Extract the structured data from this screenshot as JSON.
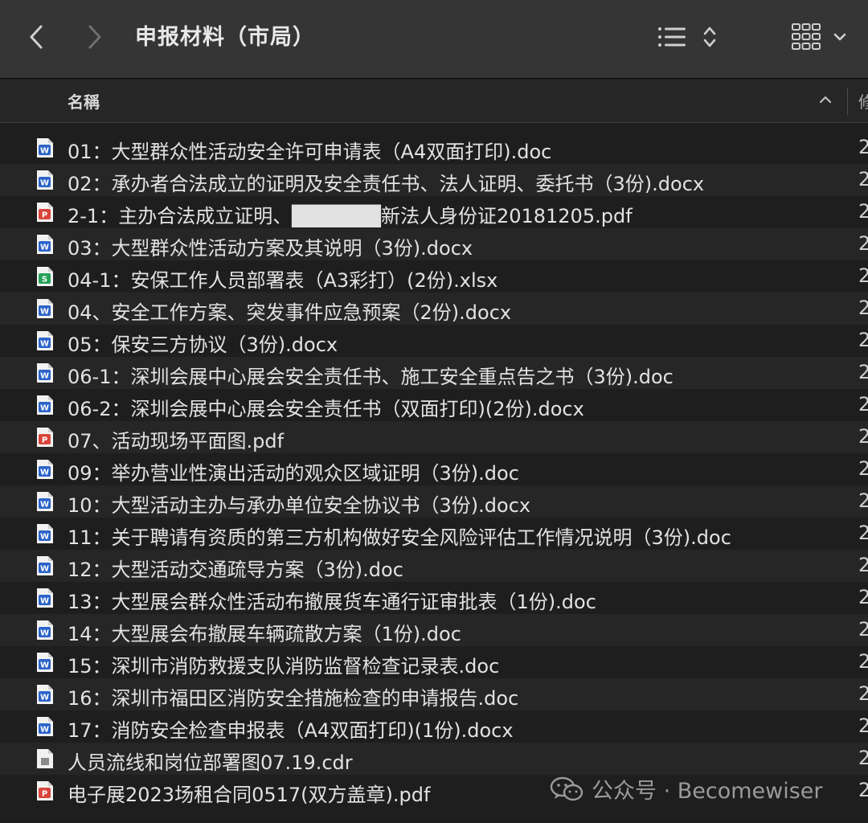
{
  "window": {
    "title": "申报材料（市局）"
  },
  "toolbar": {
    "back_icon": "chevron-left-icon",
    "forward_icon": "chevron-right-icon",
    "list_view_icon": "list-icon",
    "sort_toggle_icon": "up-down-chevron-icon",
    "grid_view_icon": "grid-icon",
    "grid_menu_icon": "chevron-down-icon"
  },
  "columns": {
    "name": "名稱",
    "next_truncated": "修",
    "sort_icon": "chevron-up-icon"
  },
  "files": [
    {
      "name": "01：大型群众性活动安全许可申请表（A4双面打印).doc",
      "type": "word",
      "date": "2"
    },
    {
      "name": "02：承办者合法成立的证明及安全责任书、法人证明、委托书（3份).docx",
      "type": "word",
      "date": "2"
    },
    {
      "name": "2-1：主办合法成立证明、██████新法人身份证20181205.pdf",
      "type": "pdf",
      "date": "2"
    },
    {
      "name": "03：大型群众性活动方案及其说明（3份).docx",
      "type": "word",
      "date": "2"
    },
    {
      "name": "04-1：安保工作人员部署表（A3彩打）(2份).xlsx",
      "type": "excel",
      "date": "2"
    },
    {
      "name": "04、安全工作方案、突发事件应急预案（2份).docx",
      "type": "word",
      "date": "2"
    },
    {
      "name": "05：保安三方协议（3份).docx",
      "type": "word",
      "date": "2"
    },
    {
      "name": "06-1：深圳会展中心展会安全责任书、施工安全重点告之书（3份).doc",
      "type": "word",
      "date": "2"
    },
    {
      "name": "06-2：深圳会展中心展会安全责任书（双面打印)(2份).docx",
      "type": "word",
      "date": "2"
    },
    {
      "name": "07、活动现场平面图.pdf",
      "type": "pdf",
      "date": "2"
    },
    {
      "name": "09：举办营业性演出活动的观众区域证明（3份).doc",
      "type": "word",
      "date": "2"
    },
    {
      "name": "10：大型活动主办与承办单位安全协议书（3份).docx",
      "type": "word",
      "date": "2"
    },
    {
      "name": "11：关于聘请有资质的第三方机构做好安全风险评估工作情况说明（3份).doc",
      "type": "word",
      "date": "2"
    },
    {
      "name": "12：大型活动交通疏导方案（3份).doc",
      "type": "word",
      "date": "2"
    },
    {
      "name": "13：大型展会群众性活动布撤展货车通行证审批表（1份).doc",
      "type": "word",
      "date": "2"
    },
    {
      "name": "14：大型展会布撤展车辆疏散方案（1份).doc",
      "type": "word",
      "date": "2"
    },
    {
      "name": "15：深圳市消防救援支队消防监督检查记录表.doc",
      "type": "word",
      "date": "2"
    },
    {
      "name": "16：深圳市福田区消防安全措施检查的申请报告.doc",
      "type": "word",
      "date": "2"
    },
    {
      "name": "17：消防安全检查申报表（A4双面打印)(1份).docx",
      "type": "word",
      "date": "2"
    },
    {
      "name": "人员流线和岗位部署图07.19.cdr",
      "type": "cdr",
      "date": "2"
    },
    {
      "name": "电子展2023场租合同0517(双方盖章).pdf",
      "type": "pdf",
      "date": "2"
    }
  ],
  "watermark": {
    "text": "公众号 · Becomewiser",
    "icon": "wechat-icon"
  },
  "colors": {
    "word": "#2b63c9",
    "pdf": "#d9463c",
    "excel": "#26a25b",
    "cdr": "#8a8a8a"
  }
}
